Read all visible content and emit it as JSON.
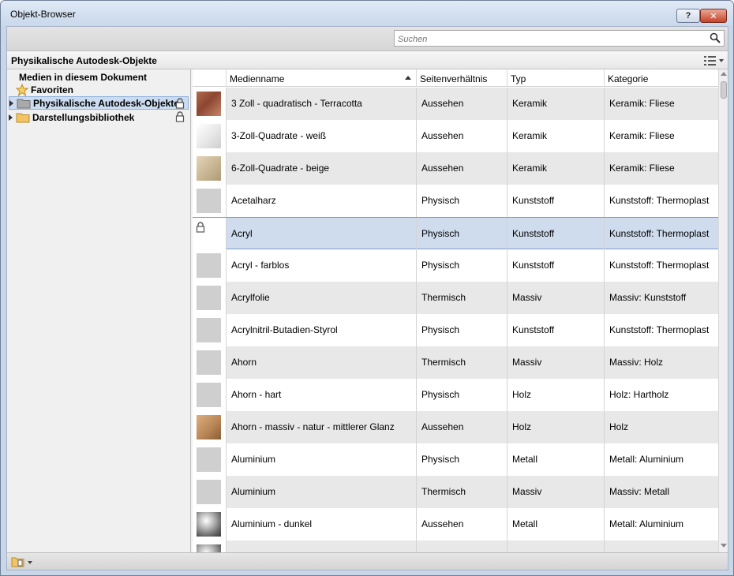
{
  "window": {
    "title": "Objekt-Browser",
    "help_label": "?",
    "close_label": "✕"
  },
  "search": {
    "placeholder": "Suchen"
  },
  "header": {
    "title": "Physikalische Autodesk-Objekte"
  },
  "tree": {
    "items": [
      {
        "label": "Medien in diesem Dokument"
      },
      {
        "label": "Favoriten"
      },
      {
        "label": "Physikalische Autodesk-Objekte"
      },
      {
        "label": "Darstellungsbibliothek"
      }
    ]
  },
  "grid": {
    "columns": [
      "Medienname",
      "Seitenverhältnis",
      "Typ",
      "Kategorie"
    ],
    "rows": [
      {
        "name": "3 Zoll - quadratisch - Terracotta",
        "ratio": "Aussehen",
        "type": "Keramik",
        "category": "Keramik: Fliese",
        "thumb": "terracotta"
      },
      {
        "name": "3-Zoll-Quadrate - weiß",
        "ratio": "Aussehen",
        "type": "Keramik",
        "category": "Keramik: Fliese",
        "thumb": "white"
      },
      {
        "name": "6-Zoll-Quadrate - beige",
        "ratio": "Aussehen",
        "type": "Keramik",
        "category": "Keramik: Fliese",
        "thumb": "beige"
      },
      {
        "name": "Acetalharz",
        "ratio": "Physisch",
        "type": "Kunststoff",
        "category": "Kunststoff: Thermoplast",
        "thumb": "plain"
      },
      {
        "name": "Acryl",
        "ratio": "Physisch",
        "type": "Kunststoff",
        "category": "Kunststoff: Thermoplast",
        "thumb": "none"
      },
      {
        "name": "Acryl - farblos",
        "ratio": "Physisch",
        "type": "Kunststoff",
        "category": "Kunststoff: Thermoplast",
        "thumb": "plain"
      },
      {
        "name": "Acrylfolie",
        "ratio": "Thermisch",
        "type": "Massiv",
        "category": "Massiv: Kunststoff",
        "thumb": "plain"
      },
      {
        "name": "Acrylnitril-Butadien-Styrol",
        "ratio": "Physisch",
        "type": "Kunststoff",
        "category": "Kunststoff: Thermoplast",
        "thumb": "plain"
      },
      {
        "name": "Ahorn",
        "ratio": "Thermisch",
        "type": "Massiv",
        "category": "Massiv: Holz",
        "thumb": "plain"
      },
      {
        "name": "Ahorn - hart",
        "ratio": "Physisch",
        "type": "Holz",
        "category": "Holz: Hartholz",
        "thumb": "plain"
      },
      {
        "name": "Ahorn - massiv - natur - mittlerer Glanz",
        "ratio": "Aussehen",
        "type": "Holz",
        "category": "Holz",
        "thumb": "wood"
      },
      {
        "name": "Aluminium",
        "ratio": "Physisch",
        "type": "Metall",
        "category": "Metall: Aluminium",
        "thumb": "plain"
      },
      {
        "name": "Aluminium",
        "ratio": "Thermisch",
        "type": "Massiv",
        "category": "Massiv: Metall",
        "thumb": "plain"
      },
      {
        "name": "Aluminium - dunkel",
        "ratio": "Aussehen",
        "type": "Metall",
        "category": "Metall: Aluminium",
        "thumb": "metal"
      },
      {
        "name": "",
        "ratio": "",
        "type": "",
        "category": "",
        "thumb": "metal"
      }
    ]
  }
}
